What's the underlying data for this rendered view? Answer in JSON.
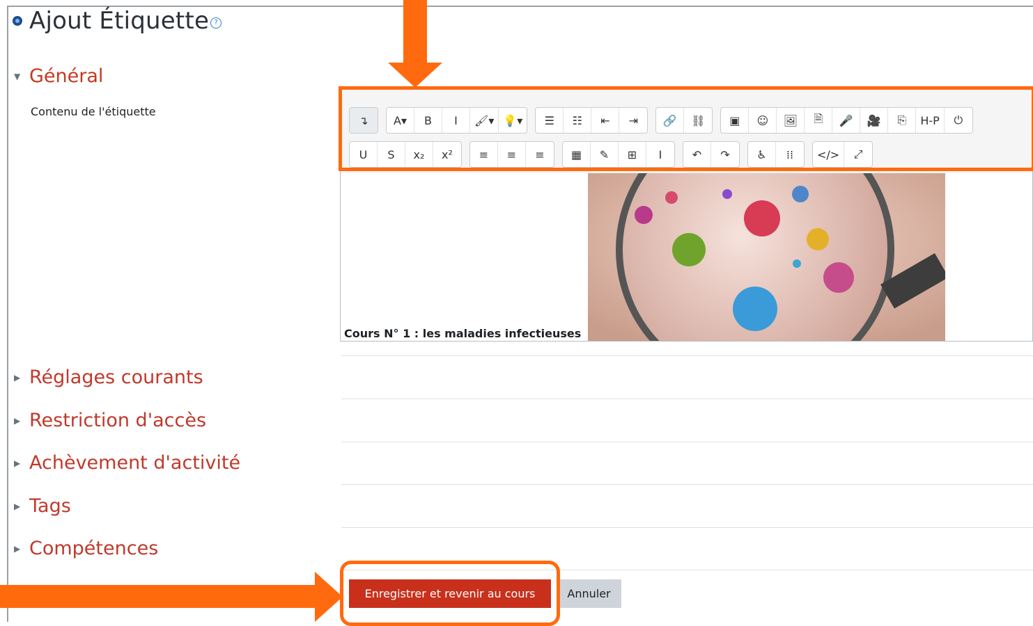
{
  "page": {
    "title": "Ajout Étiquette",
    "help_glyph": "?"
  },
  "sections": {
    "general": {
      "label": "Général",
      "field_label": "Contenu de l'étiquette"
    },
    "reglages": "Réglages courants",
    "restriction": "Restriction d'accès",
    "achevement": "Achèvement d'activité",
    "tags": "Tags",
    "competences": "Compétences"
  },
  "editor": {
    "caption": "Cours N° 1 : les maladies infectieuses",
    "toolbar_row1": [
      [
        "↴"
      ],
      [
        "A▾",
        "B",
        "I",
        "🖌▾",
        "💡▾"
      ],
      [
        "☰",
        "☷",
        "⇤",
        "⇥"
      ],
      [
        "🔗",
        "⛓"
      ],
      [
        "▣",
        "☺",
        "🖼",
        "🗎",
        "🎤",
        "🎥",
        "⎘",
        "H-P",
        "⏻"
      ]
    ],
    "toolbar_row2": [
      [
        "U",
        "S",
        "x₂",
        "x²"
      ],
      [
        "≡",
        "≡",
        "≡"
      ],
      [
        "▦",
        "✎",
        "⊞",
        "I"
      ],
      [
        "↶",
        "↷"
      ],
      [
        "♿",
        "⁞⁞"
      ],
      [
        "</>",
        "⤢"
      ]
    ]
  },
  "buttons": {
    "save": "Enregistrer et revenir au cours",
    "cancel": "Annuler"
  },
  "colors": {
    "accent_orange": "#ff6a0f",
    "section_red": "#c33a21",
    "primary_button": "#c8301c"
  }
}
